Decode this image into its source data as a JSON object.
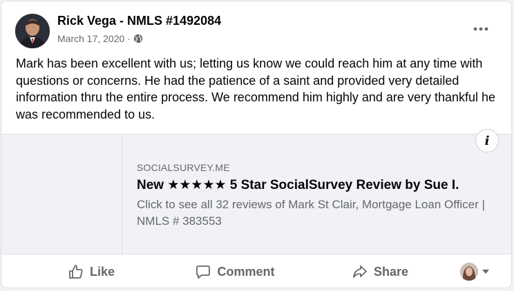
{
  "post": {
    "author": "Rick Vega - NMLS #1492084",
    "date": "March 17, 2020 · ",
    "privacy_icon": "globe-icon",
    "more_icon": "more-horizontal-icon",
    "text": "Mark has been excellent with us; letting us know we could reach him at any time with questions or concerns. He had the patience of a saint and provided very detailed information thru the entire process. We recommend him highly and are very thankful he was recommended to us."
  },
  "link_preview": {
    "domain": "SOCIALSURVEY.ME",
    "title": "New ★★★★★ 5 Star SocialSurvey Review by Sue I.",
    "description": "Click to see all 32 reviews of Mark St Clair, Mortgage Loan Officer | NMLS # 383553",
    "info_label": "i"
  },
  "actions": {
    "like": "Like",
    "comment": "Comment",
    "share": "Share"
  },
  "colors": {
    "text_primary": "#050505",
    "text_secondary": "#65676b",
    "preview_bg": "#f0f2f5",
    "divider": "#dddfe2"
  }
}
